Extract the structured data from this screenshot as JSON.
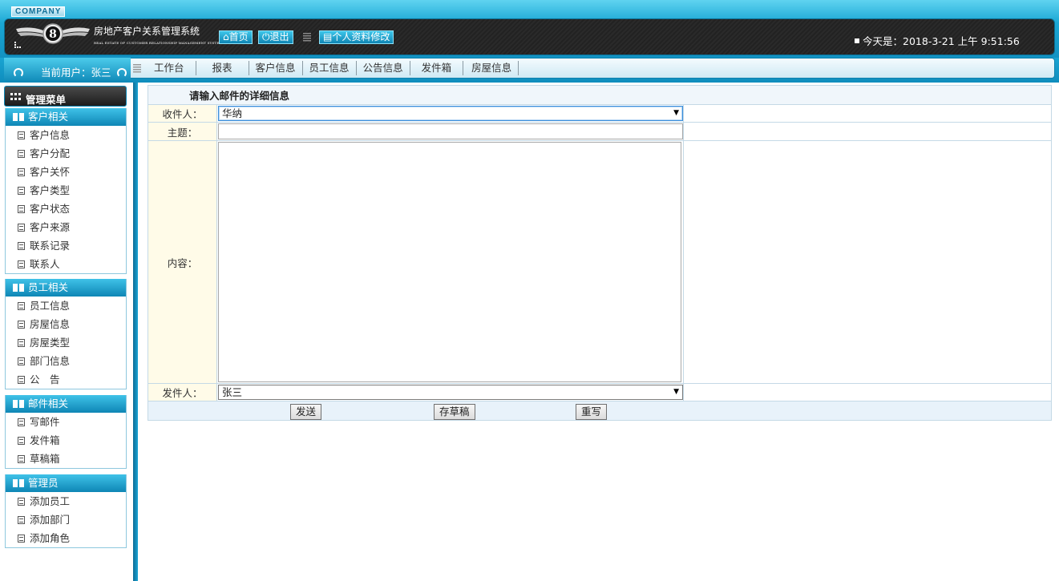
{
  "header": {
    "company": "COMPANY",
    "system_title": "房地产客户关系管理系统",
    "system_subtitle": "REAL ESTATE OF CUSTOMER RELATIONSHIP MANAGEMENT SYSTEM",
    "home_label": "首页",
    "logout_label": "退出",
    "profile_label": "个人资料修改",
    "date_text": "今天是：2018-3-21 上午 9:51:56"
  },
  "nav": {
    "current_user": "当前用户：张三",
    "items": [
      "工作台",
      "报表",
      "客户信息",
      "员工信息",
      "公告信息",
      "发件箱",
      "房屋信息"
    ]
  },
  "sidebar": {
    "title": "管理菜单",
    "groups": [
      {
        "label": "客户相关",
        "items": [
          "客户信息",
          "客户分配",
          "客户关怀",
          "客户类型",
          "客户状态",
          "客户来源",
          "联系记录",
          "联系人"
        ]
      },
      {
        "label": "员工相关",
        "items": [
          "员工信息",
          "房屋信息",
          "房屋类型",
          "部门信息",
          "公　告"
        ]
      },
      {
        "label": "邮件相关",
        "items": [
          "写邮件",
          "发件箱",
          "草稿箱"
        ]
      },
      {
        "label": "管理员",
        "items": [
          "添加员工",
          "添加部门",
          "添加角色"
        ]
      }
    ]
  },
  "form": {
    "title": "请输入邮件的详细信息",
    "recipient_label": "收件人：",
    "recipient_value": "华纳",
    "subject_label": "主题：",
    "subject_value": "",
    "content_label": "内容：",
    "content_value": "",
    "sender_label": "发件人：",
    "sender_value": "张三",
    "send_label": "发送",
    "draft_label": "存草稿",
    "reset_label": "重写"
  },
  "colors": {
    "accent": "#1392c2",
    "header_dark": "#222222",
    "label_bg": "#fffbe8"
  }
}
